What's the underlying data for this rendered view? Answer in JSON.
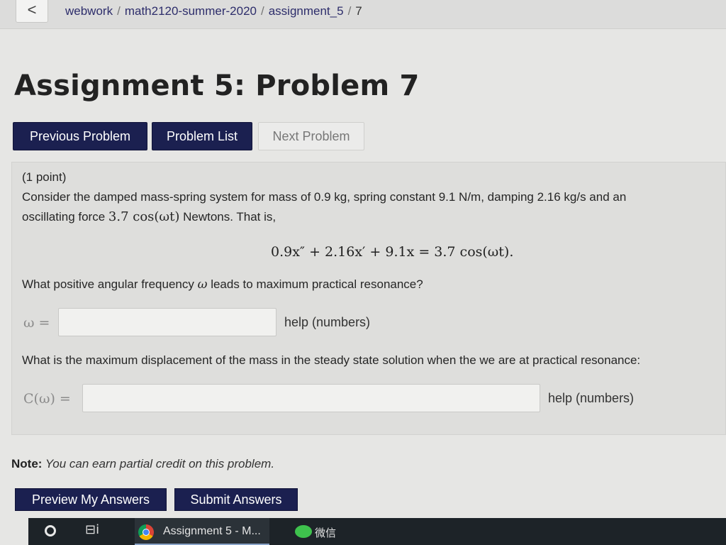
{
  "header": {
    "back_glyph": "<",
    "breadcrumb": [
      "webwork",
      "math2120-summer-2020",
      "assignment_5",
      "7"
    ],
    "sep": "/"
  },
  "page": {
    "title": "Assignment 5: Problem 7"
  },
  "nav": {
    "previous_label": "Previous Problem",
    "list_label": "Problem List",
    "next_label": "Next Problem"
  },
  "problem": {
    "points": "(1 point)",
    "intro_line1": "Consider the damped mass-spring system for mass of 0.9 kg, spring constant 9.1 N/m, damping 2.16 kg/s and an",
    "intro_line2_prefix": "oscillating force ",
    "intro_line2_math": "3.7 cos(ωt)",
    "intro_line2_suffix": " Newtons. That is,",
    "equation": "0.9x″ + 2.16x′ + 9.1x = 3.7 cos(ωt).",
    "question1_prefix": "What positive angular frequency ",
    "question1_math": "ω",
    "question1_suffix": " leads to maximum practical resonance?",
    "answer1_label": "ω =",
    "answer1_value": "",
    "help1": "help (numbers)",
    "question2": "What is the maximum displacement of the mass in the steady state solution when the we are at practical resonance:",
    "answer2_label": "C(ω) =",
    "answer2_value": "",
    "help2": "help (numbers)"
  },
  "note": {
    "label": "Note:",
    "text": " You can earn partial credit on this problem."
  },
  "actions": {
    "preview_label": "Preview My Answers",
    "submit_label": "Submit Answers"
  },
  "taskbar": {
    "active_task_label": "Assignment 5 - M...",
    "wechat_label": "微信",
    "view_glyph": "⊟i"
  }
}
